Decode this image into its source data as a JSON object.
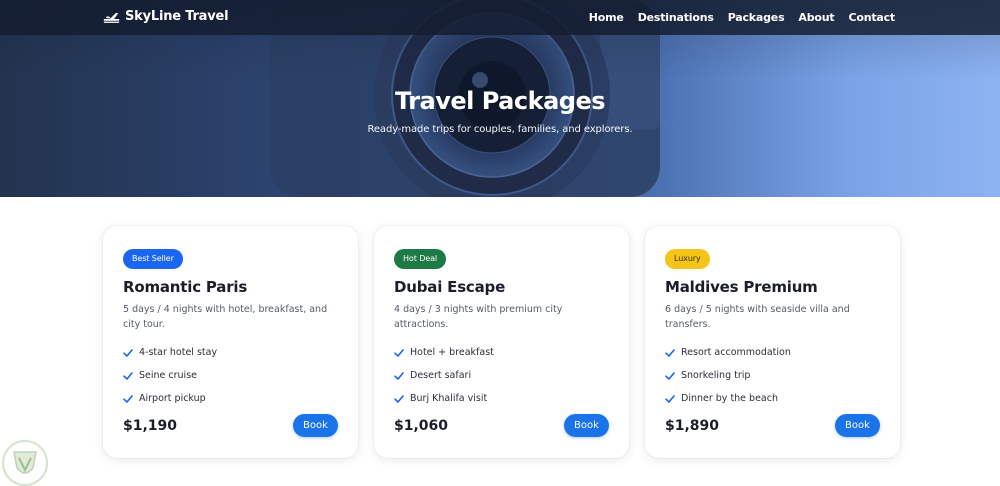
{
  "brand": {
    "name": "SkyLine Travel",
    "icon": "airplane-icon"
  },
  "nav": {
    "links": [
      "Home",
      "Destinations",
      "Packages",
      "About",
      "Contact"
    ]
  },
  "hero": {
    "title": "Travel Packages",
    "subtitle": "Ready-made trips for couples, families, and explorers."
  },
  "packages": [
    {
      "badge": "Best Seller",
      "badge_color": "#1a66f0",
      "title": "Romantic Paris",
      "description": "5 days / 4 nights with hotel, breakfast, and city tour.",
      "features": [
        "4-star hotel stay",
        "Seine cruise",
        "Airport pickup"
      ],
      "price": "$1,190",
      "button": "Book"
    },
    {
      "badge": "Hot Deal",
      "badge_color": "#1e7a45",
      "title": "Dubai Escape",
      "description": "4 days / 3 nights with premium city attractions.",
      "features": [
        "Hotel + breakfast",
        "Desert safari",
        "Burj Khalifa visit"
      ],
      "price": "$1,060",
      "button": "Book"
    },
    {
      "badge": "Luxury",
      "badge_color": "#f5c419",
      "badge_text_color": "#3a3000",
      "title": "Maldives Premium",
      "description": "6 days / 5 nights with seaside villa and transfers.",
      "features": [
        "Resort accommodation",
        "Snorkeling trip",
        "Dinner by the beach"
      ],
      "price": "$1,890",
      "button": "Book"
    }
  ],
  "colors": {
    "accent": "#1a73e8",
    "check": "#1a66f0",
    "navbar": "#141c2e"
  }
}
